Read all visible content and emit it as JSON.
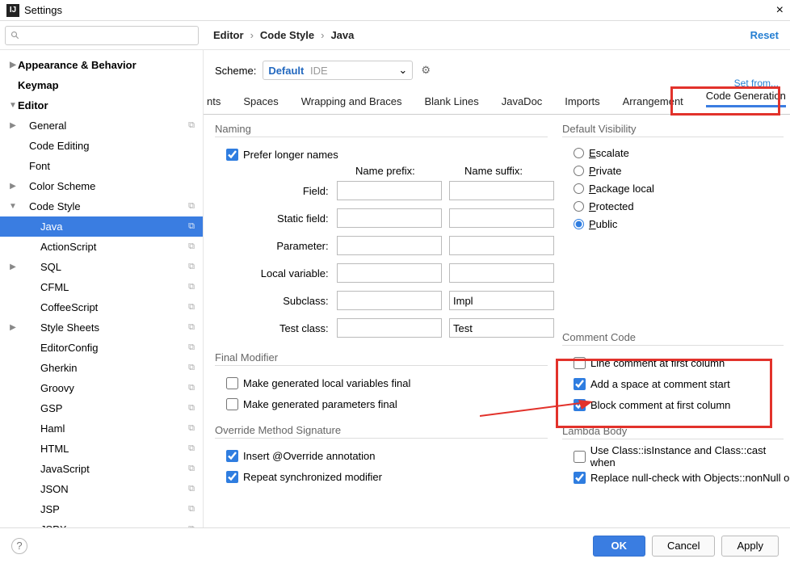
{
  "title": "Settings",
  "reset": "Reset",
  "breadcrumb": [
    "Editor",
    "Code Style",
    "Java"
  ],
  "scheme": {
    "label": "Scheme:",
    "name": "Default",
    "tag": "IDE"
  },
  "setfrom": "Set from...",
  "sidebar": [
    {
      "label": "Appearance & Behavior",
      "bold": true,
      "arr": "▶",
      "pad": 0
    },
    {
      "label": "Keymap",
      "bold": true,
      "arr": "",
      "pad": 0
    },
    {
      "label": "Editor",
      "bold": true,
      "arr": "▼",
      "pad": 0
    },
    {
      "label": "General",
      "arr": "▶",
      "pad": 1,
      "copy": true
    },
    {
      "label": "Code Editing",
      "arr": "",
      "pad": 1
    },
    {
      "label": "Font",
      "arr": "",
      "pad": 1
    },
    {
      "label": "Color Scheme",
      "arr": "▶",
      "pad": 1
    },
    {
      "label": "Code Style",
      "arr": "▼",
      "pad": 1,
      "copy": true
    },
    {
      "label": "Java",
      "arr": "",
      "pad": 2,
      "sel": true,
      "copy": true
    },
    {
      "label": "ActionScript",
      "arr": "",
      "pad": 2,
      "copy": true
    },
    {
      "label": "SQL",
      "arr": "▶",
      "pad": 2,
      "copy": true
    },
    {
      "label": "CFML",
      "arr": "",
      "pad": 2,
      "copy": true
    },
    {
      "label": "CoffeeScript",
      "arr": "",
      "pad": 2,
      "copy": true
    },
    {
      "label": "Style Sheets",
      "arr": "▶",
      "pad": 2,
      "copy": true
    },
    {
      "label": "EditorConfig",
      "arr": "",
      "pad": 2,
      "copy": true
    },
    {
      "label": "Gherkin",
      "arr": "",
      "pad": 2,
      "copy": true
    },
    {
      "label": "Groovy",
      "arr": "",
      "pad": 2,
      "copy": true
    },
    {
      "label": "GSP",
      "arr": "",
      "pad": 2,
      "copy": true
    },
    {
      "label": "Haml",
      "arr": "",
      "pad": 2,
      "copy": true
    },
    {
      "label": "HTML",
      "arr": "",
      "pad": 2,
      "copy": true
    },
    {
      "label": "JavaScript",
      "arr": "",
      "pad": 2,
      "copy": true
    },
    {
      "label": "JSON",
      "arr": "",
      "pad": 2,
      "copy": true
    },
    {
      "label": "JSP",
      "arr": "",
      "pad": 2,
      "copy": true
    },
    {
      "label": "JSPX",
      "arr": "",
      "pad": 2,
      "copy": true
    }
  ],
  "tabs": [
    "nts",
    "Spaces",
    "Wrapping and Braces",
    "Blank Lines",
    "JavaDoc",
    "Imports",
    "Arrangement",
    "Code Generation"
  ],
  "naming": {
    "title": "Naming",
    "prefer": "Prefer longer names",
    "hprefix": "Name prefix:",
    "hsuffix": "Name suffix:",
    "rows": [
      {
        "label": "Field:",
        "suffix": ""
      },
      {
        "label": "Static field:",
        "suffix": ""
      },
      {
        "label": "Parameter:",
        "suffix": ""
      },
      {
        "label": "Local variable:",
        "suffix": ""
      },
      {
        "label": "Subclass:",
        "suffix": "Impl"
      },
      {
        "label": "Test class:",
        "suffix": "Test"
      }
    ]
  },
  "visibility": {
    "title": "Default Visibility",
    "opts": [
      "Escalate",
      "Private",
      "Package local",
      "Protected",
      "Public"
    ],
    "selected": 4
  },
  "final": {
    "title": "Final Modifier",
    "c1": "Make generated local variables final",
    "c2": "Make generated parameters final"
  },
  "comment": {
    "title": "Comment Code",
    "c1": "Line comment at first column",
    "c2": "Add a space at comment start",
    "c3": "Block comment at first column"
  },
  "override": {
    "title": "Override Method Signature",
    "c1": "Insert @Override annotation",
    "c2": "Repeat synchronized modifier"
  },
  "lambda": {
    "title": "Lambda Body",
    "c1": "Use Class::isInstance and Class::cast when",
    "c2": "Replace null-check with Objects::nonNull o"
  },
  "footer": {
    "ok": "OK",
    "cancel": "Cancel",
    "apply": "Apply"
  }
}
